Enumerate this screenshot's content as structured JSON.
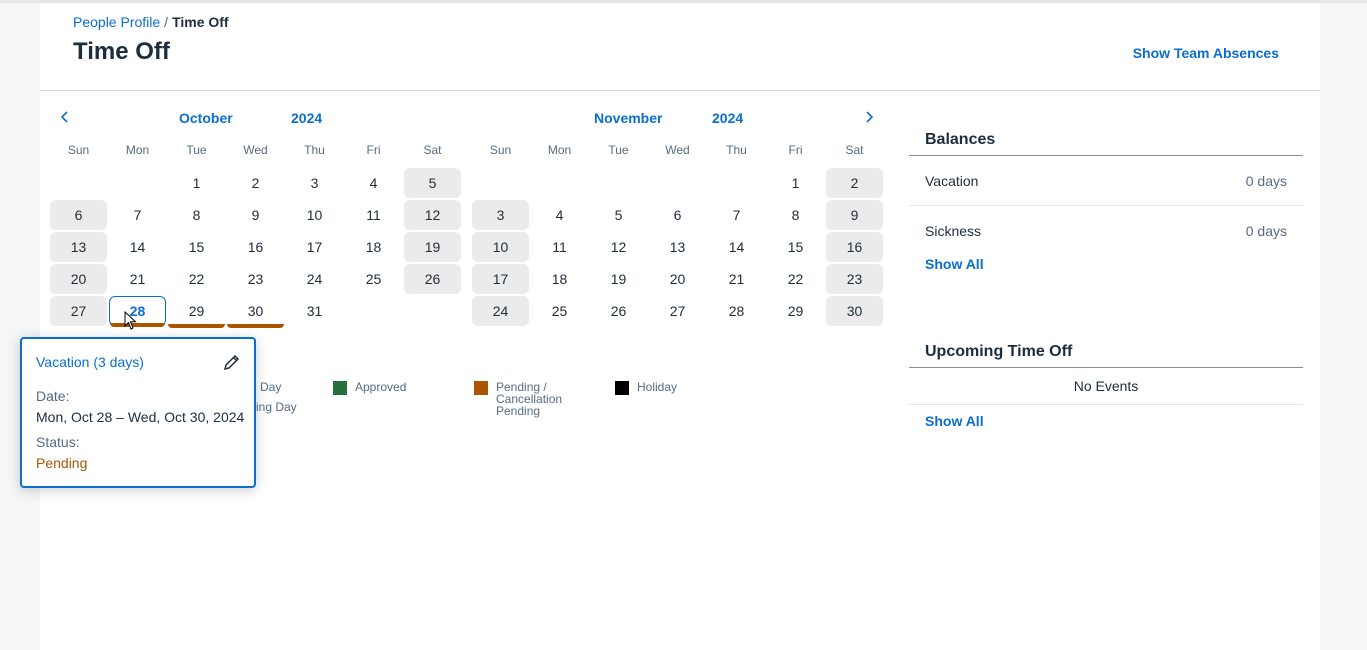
{
  "breadcrumb": {
    "parent": "People Profile",
    "separator": "/",
    "current": "Time Off"
  },
  "page_title": "Time Off",
  "team_link": "Show Team Absences",
  "weekdays": [
    "Sun",
    "Mon",
    "Tue",
    "Wed",
    "Thu",
    "Fri",
    "Sat"
  ],
  "october": {
    "month": "October",
    "year": "2024",
    "weeks": [
      [
        "",
        "",
        "1",
        "2",
        "3",
        "4",
        "5"
      ],
      [
        "6",
        "7",
        "8",
        "9",
        "10",
        "11",
        "12"
      ],
      [
        "13",
        "14",
        "15",
        "16",
        "17",
        "18",
        "19"
      ],
      [
        "20",
        "21",
        "22",
        "23",
        "24",
        "25",
        "26"
      ],
      [
        "27",
        "28",
        "29",
        "30",
        "31",
        "",
        ""
      ]
    ]
  },
  "november": {
    "month": "November",
    "year": "2024",
    "weeks": [
      [
        "",
        "",
        "",
        "",
        "",
        "1",
        "2"
      ],
      [
        "3",
        "4",
        "5",
        "6",
        "7",
        "8",
        "9"
      ],
      [
        "10",
        "11",
        "12",
        "13",
        "14",
        "15",
        "16"
      ],
      [
        "17",
        "18",
        "19",
        "20",
        "21",
        "22",
        "23"
      ],
      [
        "24",
        "25",
        "26",
        "27",
        "28",
        "29",
        "30"
      ]
    ]
  },
  "selected_day": "28",
  "pending_days": [
    "28",
    "29",
    "30"
  ],
  "legend": {
    "non_working_partial": "Day",
    "non_working_partial_2": "rking Day",
    "approved": "Approved",
    "pending": "Pending / Cancellation Pending",
    "holiday": "Holiday"
  },
  "colors": {
    "accent": "#0a6ed1",
    "approved": "#256f3a",
    "pending": "#aa5500",
    "holiday": "#000000"
  },
  "balances": {
    "title": "Balances",
    "items": [
      {
        "label": "Vacation",
        "value": "0 days"
      },
      {
        "label": "Sickness",
        "value": "0 days"
      }
    ],
    "show_all": "Show All"
  },
  "upcoming": {
    "title": "Upcoming Time Off",
    "empty": "No Events",
    "show_all": "Show All"
  },
  "popover": {
    "title": "Vacation (3 days)",
    "date_label": "Date:",
    "date_value": "Mon, Oct 28 – Wed, Oct 30, 2024",
    "status_label": "Status:",
    "status_value": "Pending",
    "edit_icon": "pencil-icon"
  }
}
